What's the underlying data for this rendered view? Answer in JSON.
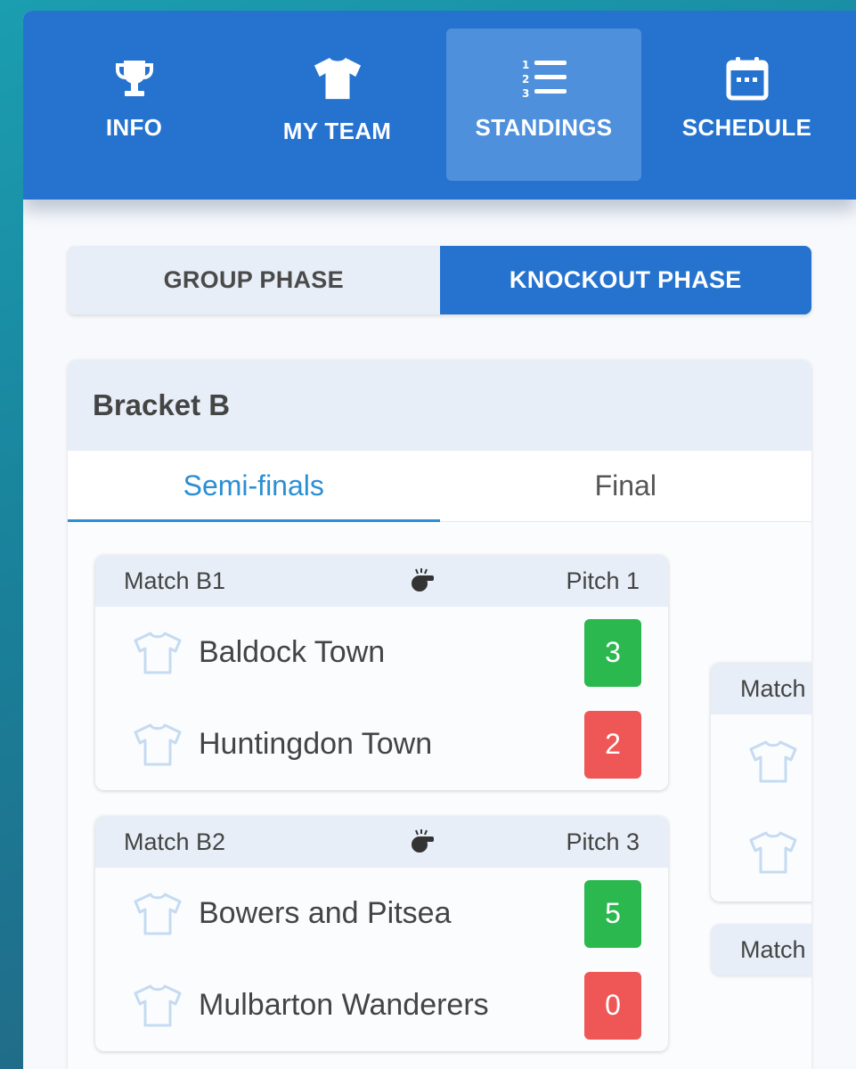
{
  "nav": {
    "items": [
      {
        "label": "INFO",
        "icon": "trophy-icon"
      },
      {
        "label": "MY TEAM",
        "icon": "shirt-icon"
      },
      {
        "label": "STANDINGS",
        "icon": "numbered-list-icon",
        "active": true
      },
      {
        "label": "SCHEDULE",
        "icon": "calendar-icon"
      }
    ]
  },
  "phases": {
    "group": "GROUP PHASE",
    "knockout": "KNOCKOUT PHASE",
    "active": "knockout"
  },
  "bracket": {
    "title": "Bracket B",
    "tabs": [
      {
        "label": "Semi-finals",
        "active": true
      },
      {
        "label": "Final",
        "active": false
      }
    ],
    "matches": [
      {
        "label": "Match B1",
        "pitch": "Pitch 1",
        "teams": [
          {
            "name": "Baldock Town",
            "score": "3",
            "result": "win"
          },
          {
            "name": "Huntingdon Town",
            "score": "2",
            "result": "lose"
          }
        ]
      },
      {
        "label": "Match B2",
        "pitch": "Pitch 3",
        "teams": [
          {
            "name": "Bowers and Pitsea",
            "score": "5",
            "result": "win"
          },
          {
            "name": "Mulbarton Wanderers",
            "score": "0",
            "result": "lose"
          }
        ]
      }
    ],
    "final_preview": [
      {
        "label": "Match"
      },
      {
        "label": "Match"
      }
    ]
  },
  "colors": {
    "primary": "#2573cf",
    "active_tab": "#2b8fd3",
    "win": "#2ab84f",
    "lose": "#ef5757"
  }
}
